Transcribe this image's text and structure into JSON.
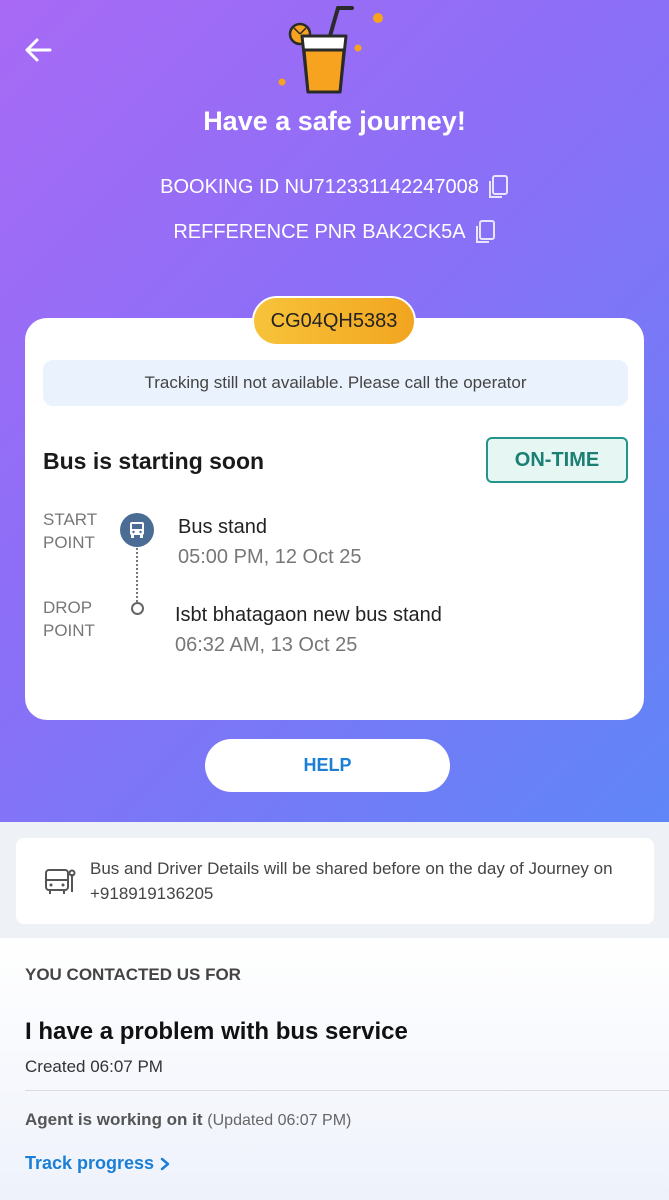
{
  "header": {
    "title": "Have a safe journey!",
    "booking_id": "BOOKING ID NU712331142247008",
    "pnr": "REFFERENCE PNR BAK2CK5A"
  },
  "ticket": {
    "bus_number": "CG04QH5383",
    "notice": "Tracking still not available. Please call the operator",
    "status_title": "Bus is starting soon",
    "status_badge": "ON-TIME",
    "start": {
      "label_line1": "START",
      "label_line2": "POINT",
      "name": "Bus stand",
      "time": "05:00 PM, 12 Oct 25"
    },
    "drop": {
      "label_line1": "DROP",
      "label_line2": "POINT",
      "name": "Isbt bhatagaon new bus stand",
      "time": "06:32 AM, 13 Oct 25"
    }
  },
  "help_button": "HELP",
  "info": {
    "text": "Bus and Driver Details will be shared before on the day of Journey on +918919136205"
  },
  "contact": {
    "heading": "YOU CONTACTED US FOR",
    "issue": "I have a problem with bus service",
    "created": "Created 06:07 PM",
    "agent_status": "Agent is working on it",
    "updated": "(Updated 06:07 PM)",
    "track_link": "Track progress"
  },
  "colors": {
    "gradient_start": "#a86af5",
    "gradient_end": "#5f86f7",
    "badge_pill": "#f2a51f",
    "ontime_green": "#23958a",
    "link_blue": "#1b7fd6"
  }
}
